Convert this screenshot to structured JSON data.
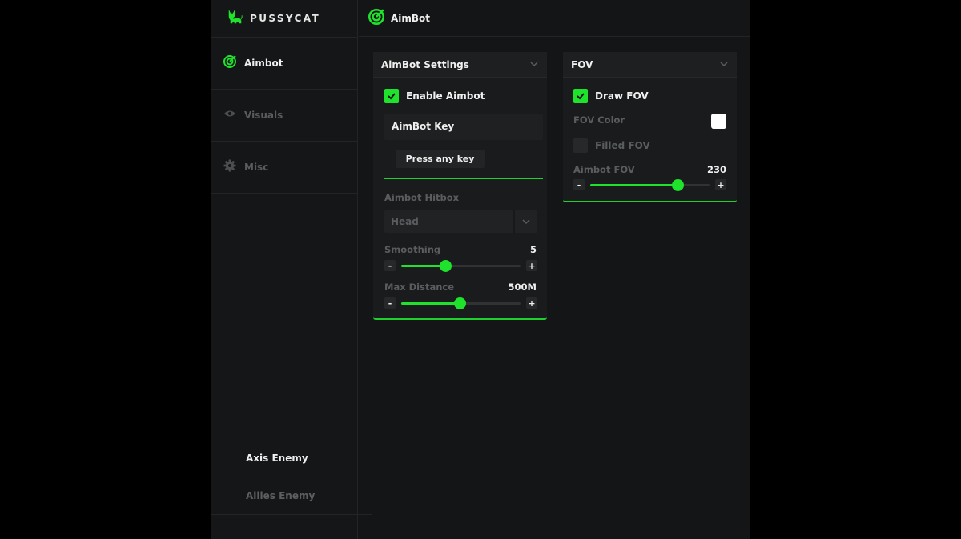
{
  "brand": {
    "name": "PUSSYCAT"
  },
  "colors": {
    "accent": "#1fe22d",
    "bg": "#141516",
    "panel": "#1a1b1c",
    "muted": "#5a5d60"
  },
  "sidebar": {
    "items": [
      {
        "label": "Aimbot",
        "icon": "aim-radar-icon",
        "active": true
      },
      {
        "label": "Visuals",
        "icon": "eye-icon",
        "active": false
      },
      {
        "label": "Misc",
        "icon": "gear-icon",
        "active": false
      }
    ],
    "bottom_items": [
      {
        "label": "Axis Enemy",
        "active": true
      },
      {
        "label": "Allies Enemy",
        "active": false
      }
    ]
  },
  "header": {
    "title": "AimBot"
  },
  "aimbot_panel": {
    "title": "AimBot Settings",
    "enable": {
      "label": "Enable Aimbot",
      "checked": true
    },
    "key": {
      "label": "AimBot Key",
      "button": "Press any key"
    },
    "hitbox": {
      "label": "Aimbot Hitbox",
      "value": "Head"
    },
    "smoothing": {
      "label": "Smoothing",
      "value": "5",
      "fraction": 0.37
    },
    "distance": {
      "label": "Max Distance",
      "value": "500M",
      "fraction": 0.49
    }
  },
  "fov_panel": {
    "title": "FOV",
    "draw": {
      "label": "Draw FOV",
      "checked": true
    },
    "color": {
      "label": "FOV Color",
      "value": "#ffffff"
    },
    "filled": {
      "label": "Filled FOV",
      "checked": false
    },
    "size": {
      "label": "Aimbot FOV",
      "value": "230",
      "fraction": 0.73
    }
  },
  "slider_buttons": {
    "minus": "-",
    "plus": "+"
  }
}
